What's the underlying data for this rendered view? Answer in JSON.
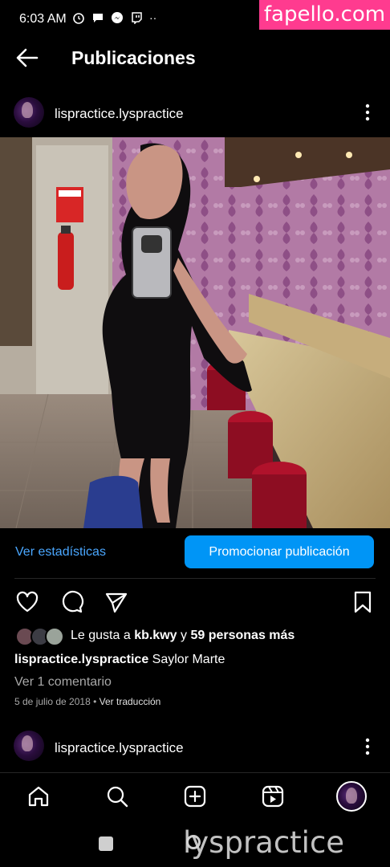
{
  "status_bar": {
    "time": "6:03 AM"
  },
  "watermark_top": "fapello.com",
  "header": {
    "title": "Publicaciones"
  },
  "post": {
    "username": "lispractice.lyspractice",
    "stats_link": "Ver estadísticas",
    "promote_label": "Promocionar publicación",
    "likes_prefix": "Le gusta a",
    "likes_user": "kb.kwy",
    "likes_and": "y",
    "likes_others": "59 personas más",
    "caption_user": "lispractice.lyspractice",
    "caption_text": "Saylor Marte",
    "comments_link": "Ver 1 comentario",
    "date": "5 de julio de 2018",
    "translate_link": "Ver traducción"
  },
  "next_post": {
    "username": "lispractice.lyspractice"
  },
  "watermark_bottom": "lyspractice",
  "colors": {
    "accent": "#0095f6",
    "link": "#4aa7ff",
    "watermark_pink": "#ff3b8f"
  }
}
